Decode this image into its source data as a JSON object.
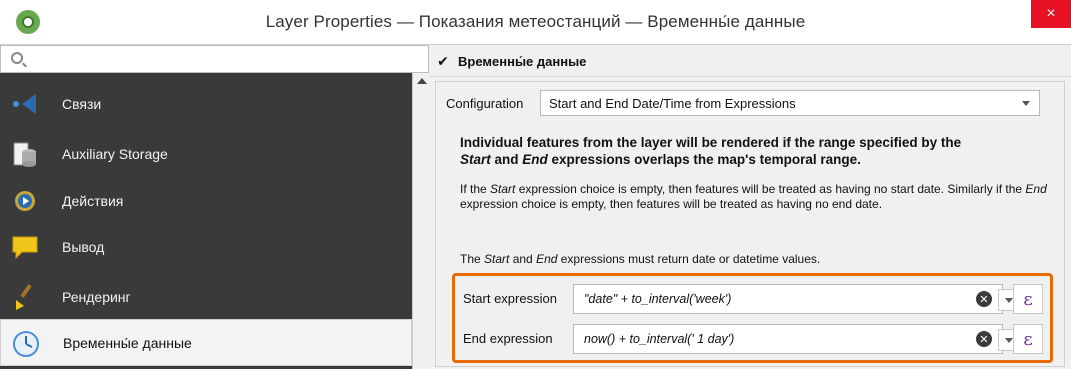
{
  "window": {
    "title": "Layer Properties — Показания метеостанций — Временны́е данные",
    "close_label": "×"
  },
  "sidebar": {
    "search_placeholder": "",
    "items": [
      {
        "label": "Связи",
        "icon": "joins-icon"
      },
      {
        "label": "Auxiliary Storage",
        "icon": "database-icon"
      },
      {
        "label": "Действия",
        "icon": "actions-gear-icon"
      },
      {
        "label": "Вывод",
        "icon": "speech-bubble-icon"
      },
      {
        "label": "Рендеринг",
        "icon": "paintbrush-icon"
      },
      {
        "label": "Временны́е данные",
        "icon": "clock-icon",
        "selected": true
      }
    ]
  },
  "main": {
    "group_checked": true,
    "check_mark": "✔",
    "group_title": "Временны́е данные",
    "configuration_label": "Configuration",
    "configuration_value": "Start and End Date/Time from Expressions",
    "desc_title_1": "Individual features from the layer will be rendered if the range specified by the",
    "desc_title_start": "Start",
    "desc_title_and": " and ",
    "desc_title_end": "End",
    "desc_title_2": " expressions overlaps the map's temporal range.",
    "body_1": "If the ",
    "body_start": "Start",
    "body_2": " expression choice is empty, then features will be treated as having no start date. Similarly if the ",
    "body_end": "End",
    "body_3": " expression choice is empty, then features will be treated as having no end date.",
    "body2_1": "The ",
    "body2_start": "Start",
    "body2_and": " and ",
    "body2_end": "End",
    "body2_2": " expressions must return date or datetime values.",
    "start_label": "Start expression",
    "start_value": "\"date\" + to_interval('week')",
    "end_label": "End expression",
    "end_value": "now() + to_interval(' 1 day')",
    "clear_glyph": "✕",
    "epsilon": "ε"
  },
  "colors": {
    "highlight": "#e86a00",
    "sidebar_bg": "#3a3a3a"
  }
}
